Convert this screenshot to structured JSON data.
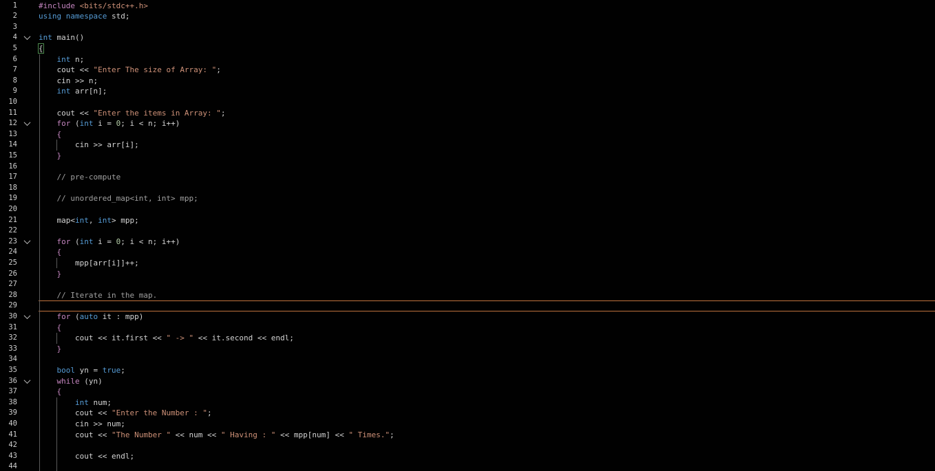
{
  "editor": {
    "lines": [
      {
        "n": "1",
        "fold": false,
        "tokens": [
          {
            "t": "#include ",
            "c": "pp"
          },
          {
            "t": "<bits/stdc++.h>",
            "c": "inc"
          }
        ]
      },
      {
        "n": "2",
        "fold": false,
        "tokens": [
          {
            "t": "using ",
            "c": "kw"
          },
          {
            "t": "namespace ",
            "c": "kw"
          },
          {
            "t": "std;",
            "c": "var"
          }
        ]
      },
      {
        "n": "3",
        "fold": false,
        "tokens": []
      },
      {
        "n": "4",
        "fold": true,
        "tokens": [
          {
            "t": "int ",
            "c": "kw"
          },
          {
            "t": "main()",
            "c": "var"
          }
        ]
      },
      {
        "n": "5",
        "fold": false,
        "tokens": [
          {
            "t": "{",
            "c": "brace"
          }
        ]
      },
      {
        "n": "6",
        "fold": false,
        "tokens": [
          {
            "t": "    int ",
            "c": "kw"
          },
          {
            "t": "n;",
            "c": "var"
          }
        ]
      },
      {
        "n": "7",
        "fold": false,
        "tokens": [
          {
            "t": "    cout << ",
            "c": "var"
          },
          {
            "t": "\"Enter The size of Array: \"",
            "c": "str"
          },
          {
            "t": ";",
            "c": "var"
          }
        ]
      },
      {
        "n": "8",
        "fold": false,
        "tokens": [
          {
            "t": "    cin >> n;",
            "c": "var"
          }
        ]
      },
      {
        "n": "9",
        "fold": false,
        "tokens": [
          {
            "t": "    int ",
            "c": "kw"
          },
          {
            "t": "arr[n];",
            "c": "var"
          }
        ]
      },
      {
        "n": "10",
        "fold": false,
        "tokens": []
      },
      {
        "n": "11",
        "fold": false,
        "tokens": [
          {
            "t": "    cout << ",
            "c": "var"
          },
          {
            "t": "\"Enter the items in Array: \"",
            "c": "str"
          },
          {
            "t": ";",
            "c": "var"
          }
        ]
      },
      {
        "n": "12",
        "fold": true,
        "tokens": [
          {
            "t": "    for ",
            "c": "ctrl"
          },
          {
            "t": "(",
            "c": "var"
          },
          {
            "t": "int ",
            "c": "kw"
          },
          {
            "t": "i = ",
            "c": "var"
          },
          {
            "t": "0",
            "c": "num"
          },
          {
            "t": "; i < n; i++)",
            "c": "var"
          }
        ]
      },
      {
        "n": "13",
        "fold": false,
        "tokens": [
          {
            "t": "    {",
            "c": "ctrl"
          }
        ]
      },
      {
        "n": "14",
        "fold": false,
        "tokens": [
          {
            "t": "        cin >> arr[i];",
            "c": "var"
          }
        ]
      },
      {
        "n": "15",
        "fold": false,
        "tokens": [
          {
            "t": "    }",
            "c": "ctrl"
          }
        ]
      },
      {
        "n": "16",
        "fold": false,
        "tokens": []
      },
      {
        "n": "17",
        "fold": false,
        "tokens": [
          {
            "t": "    // pre-compute",
            "c": "cmt"
          }
        ]
      },
      {
        "n": "18",
        "fold": false,
        "tokens": []
      },
      {
        "n": "19",
        "fold": false,
        "tokens": [
          {
            "t": "    // unordered_map<int, int> mpp;",
            "c": "cmt"
          }
        ]
      },
      {
        "n": "20",
        "fold": false,
        "tokens": []
      },
      {
        "n": "21",
        "fold": false,
        "tokens": [
          {
            "t": "    map<",
            "c": "var"
          },
          {
            "t": "int",
            "c": "kw"
          },
          {
            "t": ", ",
            "c": "var"
          },
          {
            "t": "int",
            "c": "kw"
          },
          {
            "t": "> mpp;",
            "c": "var"
          }
        ]
      },
      {
        "n": "22",
        "fold": false,
        "tokens": []
      },
      {
        "n": "23",
        "fold": true,
        "tokens": [
          {
            "t": "    for ",
            "c": "ctrl"
          },
          {
            "t": "(",
            "c": "var"
          },
          {
            "t": "int ",
            "c": "kw"
          },
          {
            "t": "i = ",
            "c": "var"
          },
          {
            "t": "0",
            "c": "num"
          },
          {
            "t": "; i < n; i++)",
            "c": "var"
          }
        ]
      },
      {
        "n": "24",
        "fold": false,
        "tokens": [
          {
            "t": "    {",
            "c": "ctrl"
          }
        ]
      },
      {
        "n": "25",
        "fold": false,
        "tokens": [
          {
            "t": "        mpp[arr[i]]++;",
            "c": "var"
          }
        ]
      },
      {
        "n": "26",
        "fold": false,
        "tokens": [
          {
            "t": "    }",
            "c": "ctrl"
          }
        ]
      },
      {
        "n": "27",
        "fold": false,
        "tokens": []
      },
      {
        "n": "28",
        "fold": false,
        "tokens": [
          {
            "t": "    // Iterate in the map.",
            "c": "cmt"
          }
        ]
      },
      {
        "n": "29",
        "fold": false,
        "tokens": [],
        "current": true
      },
      {
        "n": "30",
        "fold": true,
        "tokens": [
          {
            "t": "    for ",
            "c": "ctrl"
          },
          {
            "t": "(",
            "c": "var"
          },
          {
            "t": "auto ",
            "c": "kw"
          },
          {
            "t": "it : mpp)",
            "c": "var"
          }
        ]
      },
      {
        "n": "31",
        "fold": false,
        "tokens": [
          {
            "t": "    {",
            "c": "ctrl"
          }
        ]
      },
      {
        "n": "32",
        "fold": false,
        "tokens": [
          {
            "t": "        cout << it.first << ",
            "c": "var"
          },
          {
            "t": "\" -> \"",
            "c": "str"
          },
          {
            "t": " << it.second << endl;",
            "c": "var"
          }
        ]
      },
      {
        "n": "33",
        "fold": false,
        "tokens": [
          {
            "t": "    }",
            "c": "ctrl"
          }
        ]
      },
      {
        "n": "34",
        "fold": false,
        "tokens": []
      },
      {
        "n": "35",
        "fold": false,
        "tokens": [
          {
            "t": "    bool ",
            "c": "kw"
          },
          {
            "t": "yn = ",
            "c": "var"
          },
          {
            "t": "true",
            "c": "kw"
          },
          {
            "t": ";",
            "c": "var"
          }
        ]
      },
      {
        "n": "36",
        "fold": true,
        "tokens": [
          {
            "t": "    while ",
            "c": "ctrl"
          },
          {
            "t": "(yn)",
            "c": "var"
          }
        ]
      },
      {
        "n": "37",
        "fold": false,
        "tokens": [
          {
            "t": "    {",
            "c": "ctrl"
          }
        ]
      },
      {
        "n": "38",
        "fold": false,
        "tokens": [
          {
            "t": "        int ",
            "c": "kw"
          },
          {
            "t": "num;",
            "c": "var"
          }
        ]
      },
      {
        "n": "39",
        "fold": false,
        "tokens": [
          {
            "t": "        cout << ",
            "c": "var"
          },
          {
            "t": "\"Enter the Number : \"",
            "c": "str"
          },
          {
            "t": ";",
            "c": "var"
          }
        ]
      },
      {
        "n": "40",
        "fold": false,
        "tokens": [
          {
            "t": "        cin >> num;",
            "c": "var"
          }
        ]
      },
      {
        "n": "41",
        "fold": false,
        "tokens": [
          {
            "t": "        cout << ",
            "c": "var"
          },
          {
            "t": "\"The Number \"",
            "c": "str"
          },
          {
            "t": " << num << ",
            "c": "var"
          },
          {
            "t": "\" Having : \"",
            "c": "str"
          },
          {
            "t": " << mpp[num] << ",
            "c": "var"
          },
          {
            "t": "\" Times.\"",
            "c": "str"
          },
          {
            "t": ";",
            "c": "var"
          }
        ]
      },
      {
        "n": "42",
        "fold": false,
        "tokens": []
      },
      {
        "n": "43",
        "fold": false,
        "tokens": [
          {
            "t": "        cout << endl;",
            "c": "var"
          }
        ]
      },
      {
        "n": "44",
        "fold": false,
        "tokens": []
      }
    ],
    "colors": {
      "background": "#010101",
      "current_line_border": "#c0733d",
      "keyword": "#569cd6",
      "control": "#c586c0",
      "string": "#ce9178",
      "number": "#b5cea8",
      "comment": "#a0a0a0"
    }
  }
}
